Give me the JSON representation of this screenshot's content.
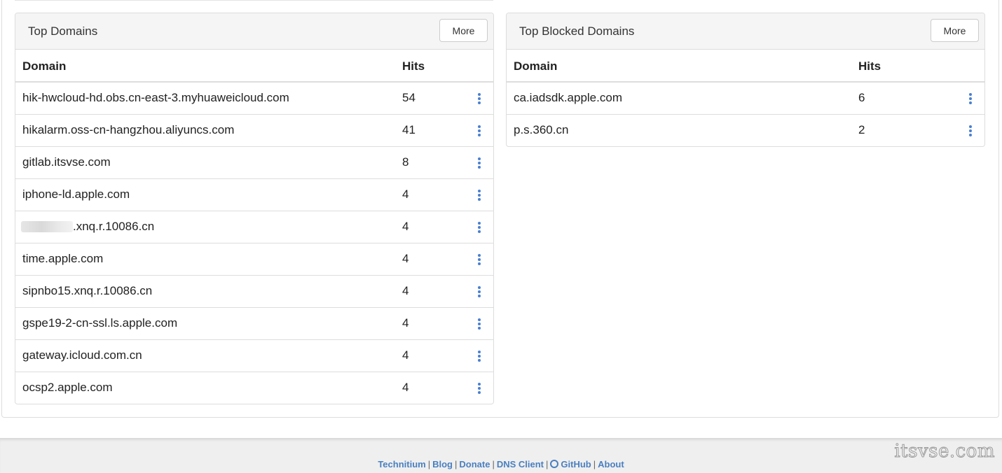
{
  "top_domains": {
    "title": "Top Domains",
    "more_label": "More",
    "columns": {
      "domain": "Domain",
      "hits": "Hits"
    },
    "rows": [
      {
        "domain": "hik-hwcloud-hd.obs.cn-east-3.myhuaweicloud.com",
        "hits": "54"
      },
      {
        "domain": "hikalarm.oss-cn-hangzhou.aliyuncs.com",
        "hits": "41"
      },
      {
        "domain": "gitlab.itsvse.com",
        "hits": "8"
      },
      {
        "domain": "iphone-ld.apple.com",
        "hits": "4"
      },
      {
        "domain": ".xnq.r.10086.cn",
        "hits": "4"
      },
      {
        "domain": "time.apple.com",
        "hits": "4"
      },
      {
        "domain": "sipnbo15.xnq.r.10086.cn",
        "hits": "4"
      },
      {
        "domain": "gspe19-2-cn-ssl.ls.apple.com",
        "hits": "4"
      },
      {
        "domain": "gateway.icloud.com.cn",
        "hits": "4"
      },
      {
        "domain": "ocsp2.apple.com",
        "hits": "4"
      }
    ]
  },
  "top_blocked_domains": {
    "title": "Top Blocked Domains",
    "more_label": "More",
    "columns": {
      "domain": "Domain",
      "hits": "Hits"
    },
    "rows": [
      {
        "domain": "ca.iadsdk.apple.com",
        "hits": "6"
      },
      {
        "domain": "p.s.360.cn",
        "hits": "2"
      }
    ]
  },
  "footer": {
    "links": [
      "Technitium",
      "Blog",
      "Donate",
      "DNS Client",
      "GitHub",
      "About"
    ],
    "separator": "|"
  },
  "watermark": "itsvse.com",
  "icons": {
    "row_menu": "kebab-menu-icon",
    "github": "github-icon"
  },
  "colors": {
    "link": "#4a7fc0",
    "menu_dots": "#4a7fd0"
  }
}
